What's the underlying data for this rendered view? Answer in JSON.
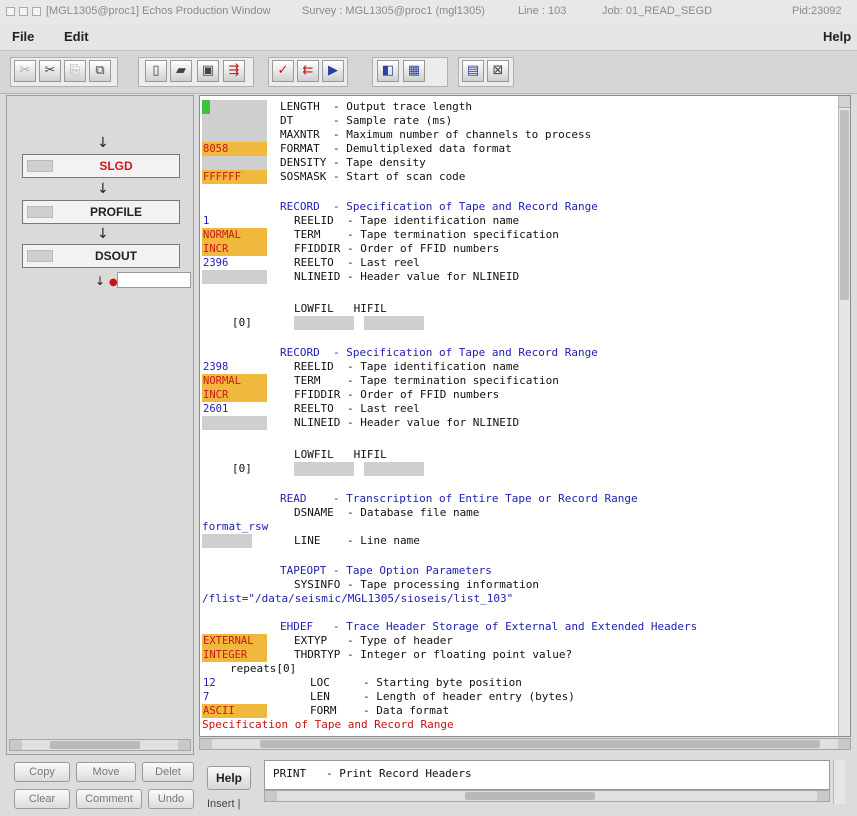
{
  "titlebar": {
    "window": "[MGL1305@proc1] Echos Production Window",
    "survey": "Survey : MGL1305@proc1 (mgl1305)",
    "line": "Line : 103",
    "job": "Job: 01_READ_SEGD",
    "pid": "Pid:23092"
  },
  "menubar": {
    "file": "File",
    "edit": "Edit",
    "help": "Help"
  },
  "toolbar": {
    "icons": [
      "cut-icon",
      "cut-selected-icon",
      "copy-icon",
      "copy-doc-icon",
      "new-doc-icon",
      "open-folder-icon",
      "save-icon",
      "export-red-icon",
      "check-red-icon",
      "import-red-icon",
      "run-icon",
      "panel-left-icon",
      "panel-table-icon",
      "layout-icon",
      "monitor-icon"
    ]
  },
  "flow": {
    "modules": [
      "SLGD",
      "PROFILE",
      "DSOUT"
    ],
    "active": "SLGD"
  },
  "left_buttons": {
    "copy": "Copy",
    "move": "Move",
    "delete": "Delet",
    "clear": "Clear",
    "comment": "Comment",
    "undo": "Undo"
  },
  "editor": {
    "lines": [
      "LENGTH  - Output trace length",
      "DT      - Sample rate (ms)",
      "MAXNTR  - Maximum number of channels to process",
      "FORMAT  - Demultiplexed data format",
      "DENSITY - Tape density",
      "SOSMASK - Start of scan code",
      "RECORD  - Specification of Tape and Record Range",
      "REELID  - Tape identification name",
      "TERM    - Tape termination specification",
      "FFIDDIR - Order of FFID numbers",
      "REELTO  - Last reel",
      "NLINEID - Header value for NLINEID",
      "LOWFIL   HIFIL",
      "[0]",
      "RECORD  - Specification of Tape and Record Range",
      "REELID  - Tape identification name",
      "TERM    - Tape termination specification",
      "FFIDDIR - Order of FFID numbers",
      "REELTO  - Last reel",
      "NLINEID - Header value for NLINEID",
      "LOWFIL   HIFIL",
      "[0]",
      "READ    - Transcription of Entire Tape or Record Range",
      "DSNAME  - Database file name",
      "format_rsw",
      "LINE    - Line name",
      "TAPEOPT - Tape Option Parameters",
      "SYSINFO - Tape processing information",
      "/flist=\"/data/seismic/MGL1305/sioseis/list_103\"",
      "EHDEF   - Trace Header Storage of External and Extended Headers",
      "EXTYP   - Type of header",
      "THDRTYP - Integer or floating point value?",
      "repeats[0]",
      "LOC     - Starting byte position",
      "LEN     - Length of header entry (bytes)",
      "FORM    - Data format",
      "Specification of Tape and Record Range"
    ],
    "values": {
      "format": "8058",
      "sosmask": "FFFFFF",
      "reelid1": "1",
      "term1": "NORMAL",
      "ffiddir1": "INCR",
      "reelto1": "2396",
      "reelid2": "2398",
      "term2": "NORMAL",
      "ffiddir2": "INCR",
      "reelto2": "2601",
      "extyp": "EXTERNAL",
      "thdrtyp": "INTEGER",
      "loc": "12",
      "len": "7",
      "form": "ASCII"
    }
  },
  "bottom": {
    "help_label": "Help",
    "help_text": "PRINT   - Print Record Headers",
    "insert_label": "Insert |"
  }
}
